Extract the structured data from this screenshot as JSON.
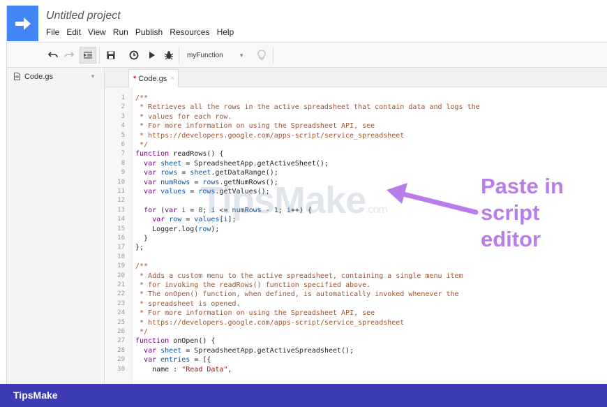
{
  "app": {
    "project_title": "Untitled project",
    "menu": [
      "File",
      "Edit",
      "View",
      "Run",
      "Publish",
      "Resources",
      "Help"
    ]
  },
  "toolbar": {
    "icons": [
      "undo-icon",
      "redo-icon",
      "indent-icon",
      "save-icon",
      "triggers-icon",
      "run-icon",
      "debug-icon",
      "lightbulb-icon"
    ],
    "function_select": "myFunction"
  },
  "sidebar": {
    "file_name": "Code.gs"
  },
  "tabs": [
    {
      "label": "Code.gs",
      "modified_marker": "*",
      "close": "×"
    }
  ],
  "code": {
    "lines": [
      {
        "n": "1",
        "text": "/**"
      },
      {
        "n": "2",
        "text": " * Retrieves all the rows in the active spreadsheet that contain data and logs the"
      },
      {
        "n": "3",
        "text": " * values for each row."
      },
      {
        "n": "4",
        "text": " * For more information on using the Spreadsheet API, see"
      },
      {
        "n": "5",
        "text": " * https://developers.google.com/apps-script/service_spreadsheet"
      },
      {
        "n": "6",
        "text": " */"
      },
      {
        "n": "7",
        "text": "function readRows() {"
      },
      {
        "n": "8",
        "text": "  var sheet = SpreadsheetApp.getActiveSheet();"
      },
      {
        "n": "9",
        "text": "  var rows = sheet.getDataRange();"
      },
      {
        "n": "10",
        "text": "  var numRows = rows.getNumRows();"
      },
      {
        "n": "11",
        "text": "  var values = rows.getValues();"
      },
      {
        "n": "12",
        "text": ""
      },
      {
        "n": "13",
        "text": "  for (var i = 0; i <= numRows - 1; i++) {"
      },
      {
        "n": "14",
        "text": "    var row = values[i];"
      },
      {
        "n": "15",
        "text": "    Logger.log(row);"
      },
      {
        "n": "16",
        "text": "  }"
      },
      {
        "n": "17",
        "text": "};"
      },
      {
        "n": "18",
        "text": ""
      },
      {
        "n": "19",
        "text": "/**"
      },
      {
        "n": "20",
        "text": " * Adds a custom menu to the active spreadsheet, containing a single menu item"
      },
      {
        "n": "21",
        "text": " * for invoking the readRows() function specified above."
      },
      {
        "n": "22",
        "text": " * The onOpen() function, when defined, is automatically invoked whenever the"
      },
      {
        "n": "23",
        "text": " * spreadsheet is opened."
      },
      {
        "n": "24",
        "text": " * For more information on using the Spreadsheet API, see"
      },
      {
        "n": "25",
        "text": " * https://developers.google.com/apps-script/service_spreadsheet"
      },
      {
        "n": "26",
        "text": " */"
      },
      {
        "n": "27",
        "text": "function onOpen() {"
      },
      {
        "n": "28",
        "text": "  var sheet = SpreadsheetApp.getActiveSpreadsheet();"
      },
      {
        "n": "29",
        "text": "  var entries = [{"
      },
      {
        "n": "30",
        "text": "    name : \"Read Data\","
      }
    ]
  },
  "watermark": {
    "brand": "TipsMake",
    "suffix": ".com"
  },
  "annotation": {
    "line1": "Paste in",
    "line2": "script",
    "line3": "editor",
    "color": "#b97dea"
  },
  "footer": {
    "brand": "TipsMake",
    "background": "#3d3cb5"
  },
  "colors": {
    "logo_blue": "#4285f4"
  }
}
